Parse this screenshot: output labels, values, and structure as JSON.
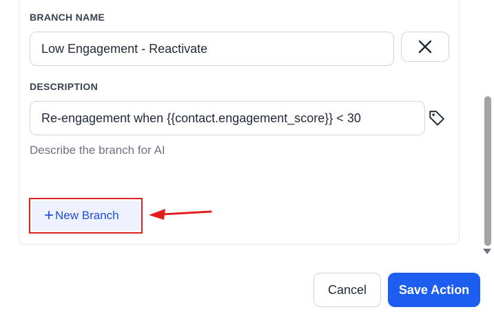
{
  "branch": {
    "label": "BRANCH NAME",
    "name_value": "Low Engagement - Reactivate"
  },
  "description": {
    "label": "DESCRIPTION",
    "value": "Re-engagement when {{contact.engagement_score}} < 30",
    "helper": "Describe the branch for AI"
  },
  "new_branch": {
    "plus": "+",
    "label": "New Branch"
  },
  "footer": {
    "cancel_label": "Cancel",
    "save_label": "Save Action"
  },
  "icons": {
    "remove": "close-icon",
    "tag": "tag-icon",
    "annotation": "arrow-left-icon"
  },
  "colors": {
    "accent": "#1d5ef0",
    "highlight": "#e11d1d",
    "new_branch_bg": "#eef2ff"
  }
}
